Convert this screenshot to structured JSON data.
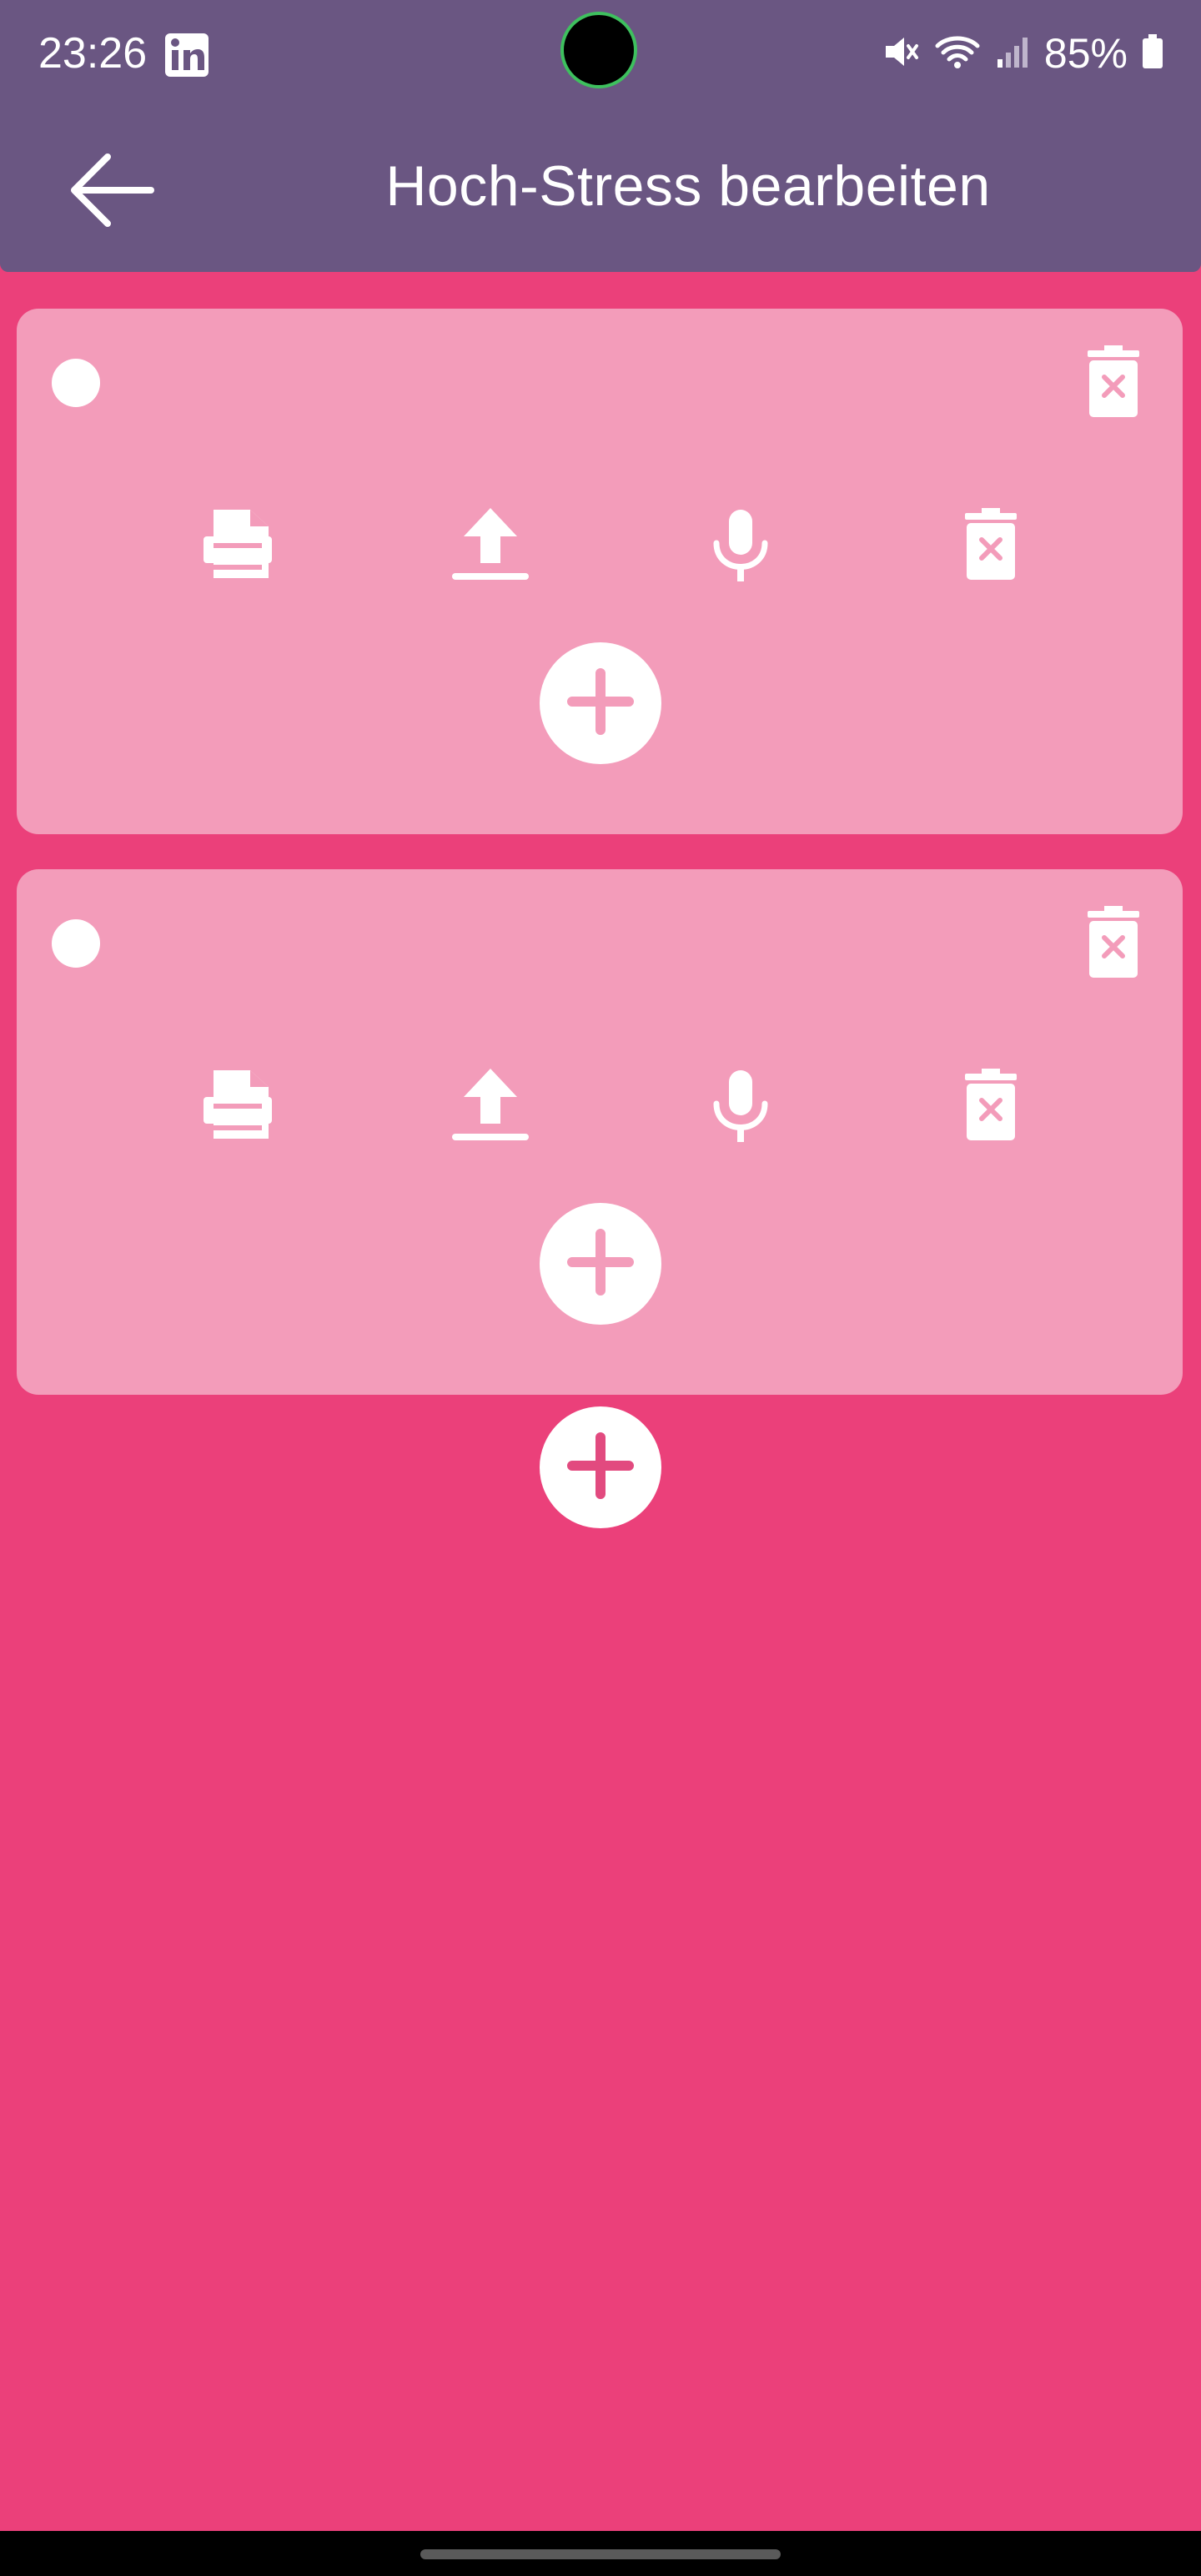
{
  "status_bar": {
    "time": "23:26",
    "app_icon": "linkedin-icon",
    "icons": [
      "mute-icon",
      "wifi-icon",
      "signal-icon"
    ],
    "battery_percent": "85%"
  },
  "app_bar": {
    "title": "Hoch-Stress bearbeiten",
    "back_icon": "arrow-back-icon",
    "color": "#6A5682"
  },
  "cards": [
    {
      "select_icon": "circle-icon",
      "delete_icon": "trash-x-icon",
      "actions": [
        "document-icon",
        "upload-icon",
        "microphone-icon",
        "trash-x-icon"
      ],
      "add_icon": "plus-icon"
    },
    {
      "select_icon": "circle-icon",
      "delete_icon": "trash-x-icon",
      "actions": [
        "document-icon",
        "upload-icon",
        "microphone-icon",
        "trash-x-icon"
      ],
      "add_icon": "plus-icon"
    }
  ],
  "fab": {
    "icon": "plus-icon"
  },
  "colors": {
    "background": "#EB407A",
    "card": "#F39CBA",
    "header": "#6A5682",
    "accent": "#E24A7F"
  }
}
